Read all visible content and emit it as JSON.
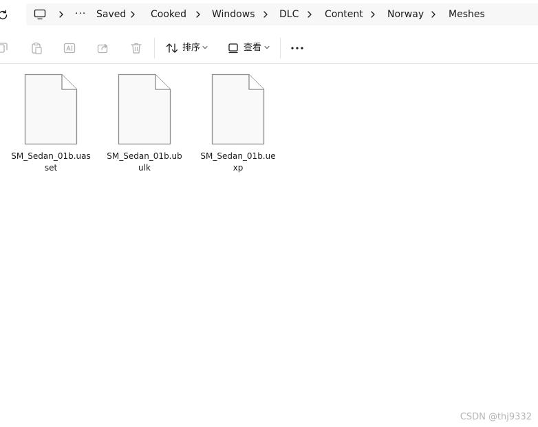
{
  "address_bar": {
    "overflow_label": "···",
    "crumbs": [
      "Saved",
      "Cooked",
      "Windows",
      "DLC",
      "Content",
      "Norway",
      "Meshes"
    ]
  },
  "toolbar": {
    "sort_label": "排序",
    "view_label": "查看",
    "more_label": "···"
  },
  "files": [
    {
      "name": "SM_Sedan_01b.uasset",
      "icon": "generic-file-icon"
    },
    {
      "name": "SM_Sedan_01b.ubulk",
      "icon": "generic-file-icon"
    },
    {
      "name": "SM_Sedan_01b.uexp",
      "icon": "generic-file-icon"
    }
  ],
  "watermark": "CSDN @thj9332",
  "colors": {
    "address_background": "#f7f7f7",
    "disabled_icon": "#b0b0b0",
    "file_outline": "#8a8a8a",
    "file_fill": "#f9f9f9",
    "watermark": "#b5b5b5"
  }
}
